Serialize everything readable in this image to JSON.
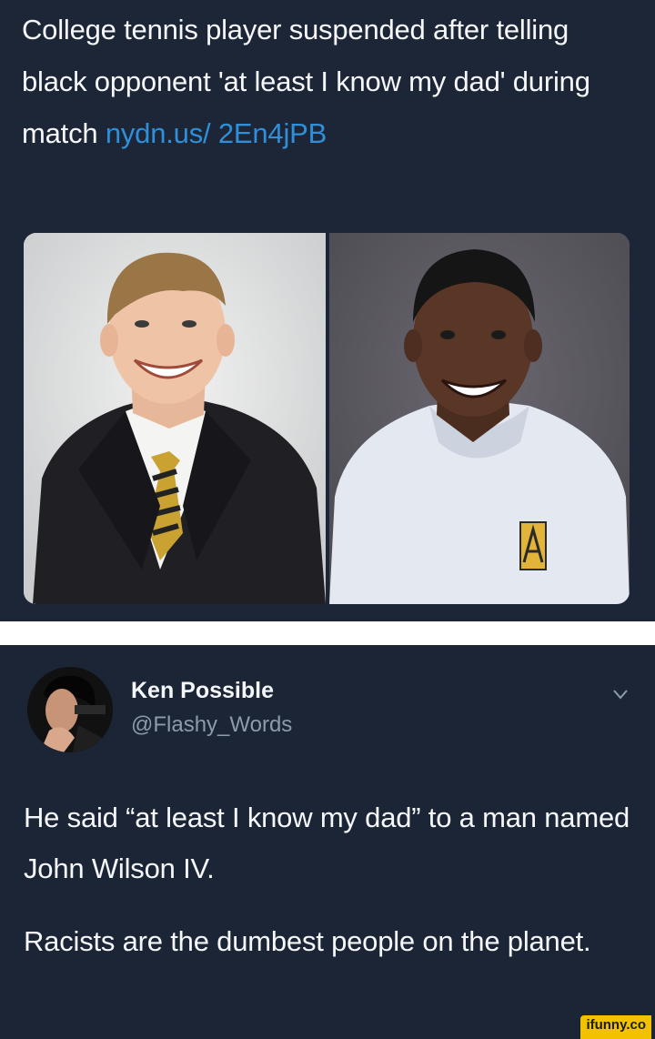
{
  "post": {
    "headline": "College tennis player suspended after telling black opponent 'at least I know my dad' during match ",
    "link": "nydn.us/ 2En4jPB"
  },
  "reply": {
    "display_name": "Ken Possible",
    "handle": "@Flashy_Words",
    "paragraph_1": "He said “at least I know my dad” to a man named John Wilson IV.",
    "paragraph_2": "Racists are the dumbest people on the planet."
  },
  "watermark": "ifunny.co",
  "colors": {
    "background": "#1c2637",
    "link": "#2f8fd8",
    "handle": "#8d9aab",
    "watermark": "#f2c200"
  },
  "icons": {
    "menu": "chevron-down-icon",
    "logo_on_shirt": "university-logo-icon"
  }
}
